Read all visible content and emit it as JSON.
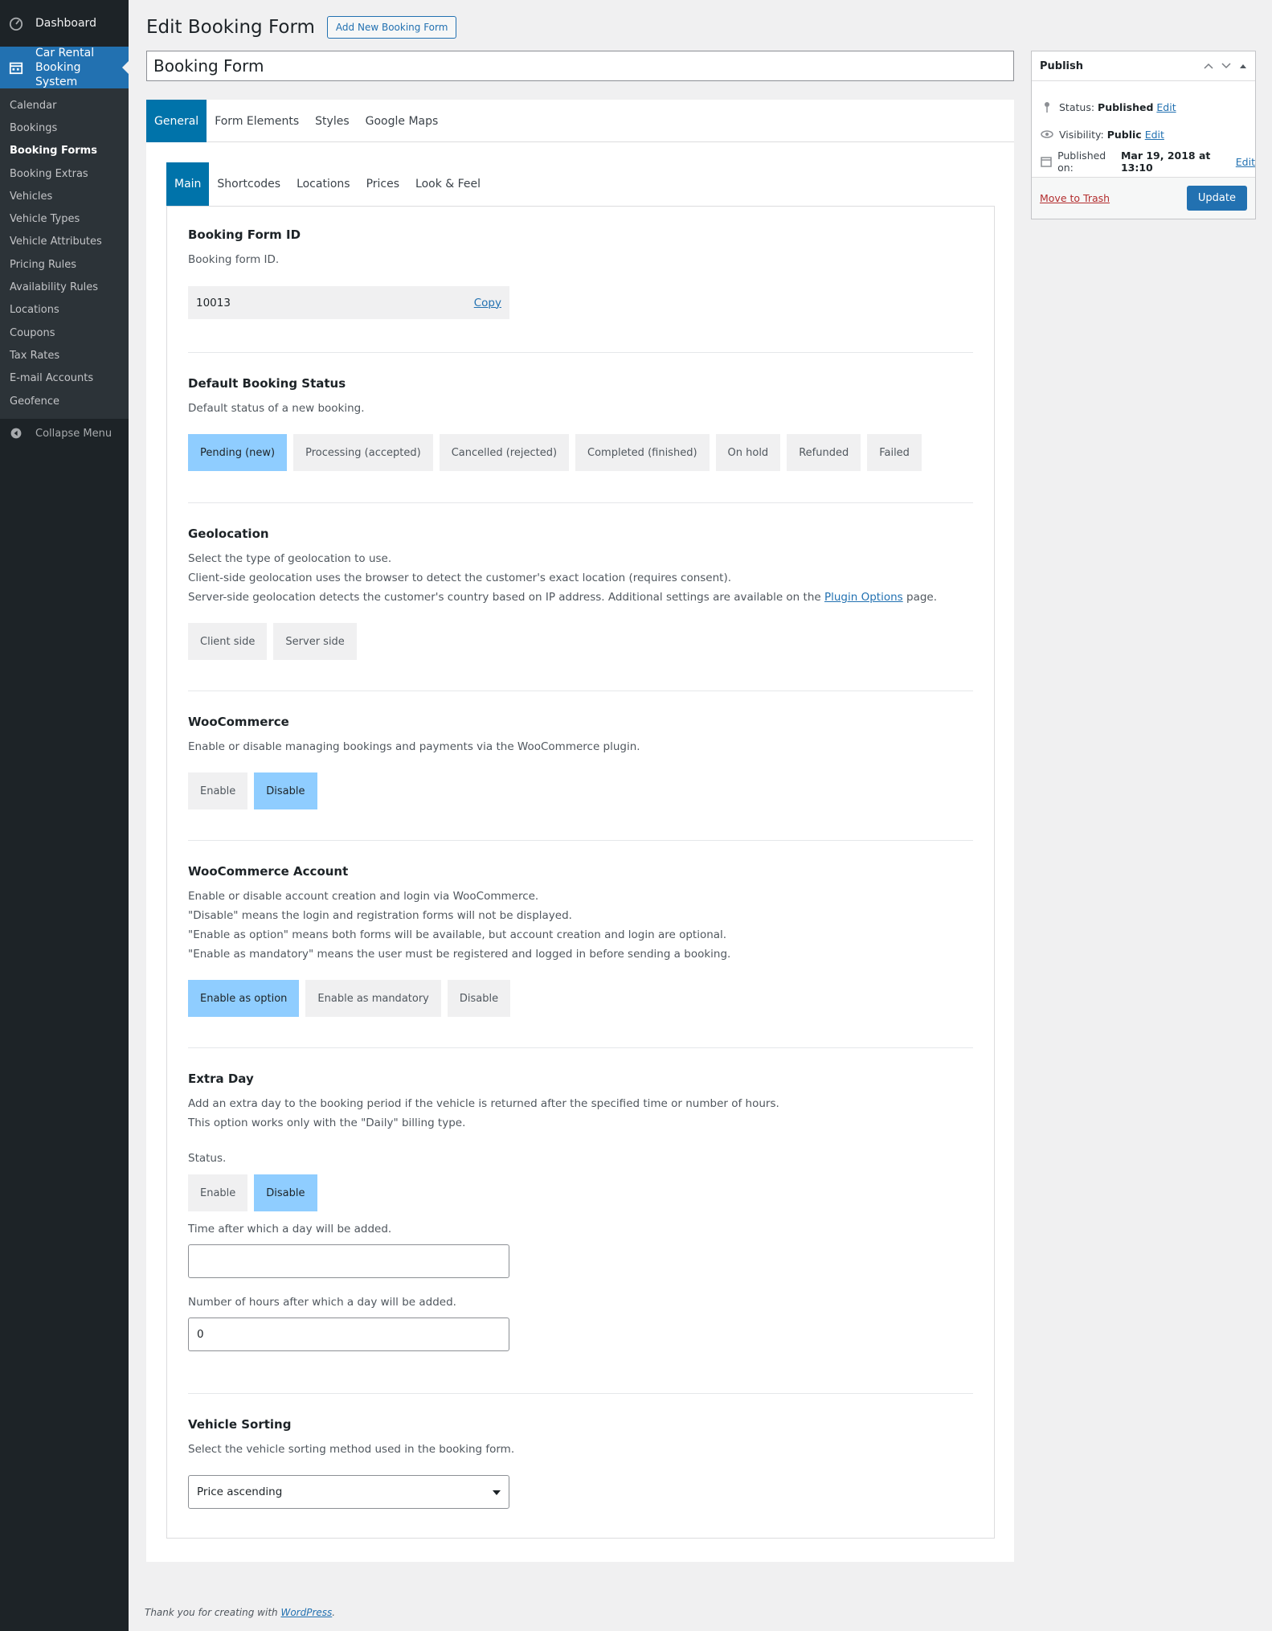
{
  "sidebar": {
    "dashboard": "Dashboard",
    "current": "Car Rental Booking System",
    "items": [
      {
        "label": "Calendar"
      },
      {
        "label": "Bookings"
      },
      {
        "label": "Booking Forms"
      },
      {
        "label": "Booking Extras"
      },
      {
        "label": "Vehicles"
      },
      {
        "label": "Vehicle Types"
      },
      {
        "label": "Vehicle Attributes"
      },
      {
        "label": "Pricing Rules"
      },
      {
        "label": "Availability Rules"
      },
      {
        "label": "Locations"
      },
      {
        "label": "Coupons"
      },
      {
        "label": "Tax Rates"
      },
      {
        "label": "E-mail Accounts"
      },
      {
        "label": "Geofence"
      }
    ],
    "collapse": "Collapse Menu"
  },
  "header": {
    "title": "Edit Booking Form",
    "add_new": "Add New Booking Form",
    "post_title": "Booking Form"
  },
  "tabs_main": [
    "General",
    "Form Elements",
    "Styles",
    "Google Maps"
  ],
  "tabs_sub": [
    "Main",
    "Shortcodes",
    "Locations",
    "Prices",
    "Look & Feel"
  ],
  "sections": {
    "form_id": {
      "title": "Booking Form ID",
      "desc": "Booking form ID.",
      "value": "10013",
      "copy": "Copy"
    },
    "status": {
      "title": "Default Booking Status",
      "desc": "Default status of a new booking.",
      "options": [
        "Pending (new)",
        "Processing (accepted)",
        "Cancelled (rejected)",
        "Completed (finished)",
        "On hold",
        "Refunded",
        "Failed"
      ]
    },
    "geo": {
      "title": "Geolocation",
      "line1": "Select the type of geolocation to use.",
      "line2": "Client-side geolocation uses the browser to detect the customer's exact location (requires consent).",
      "line3_pre": "Server-side geolocation detects the customer's country based on IP address. Additional settings are available on the ",
      "line3_link": "Plugin Options",
      "line3_post": " page.",
      "options": [
        "Client side",
        "Server side"
      ]
    },
    "woo": {
      "title": "WooCommerce",
      "desc": "Enable or disable managing bookings and payments via the WooCommerce plugin.",
      "options": [
        "Enable",
        "Disable"
      ]
    },
    "woo_account": {
      "title": "WooCommerce Account",
      "line1": "Enable or disable account creation and login via WooCommerce.",
      "line2": "\"Disable\" means the login and registration forms will not be displayed.",
      "line3": "\"Enable as option\" means both forms will be available, but account creation and login are optional.",
      "line4": "\"Enable as mandatory\" means the user must be registered and logged in before sending a booking.",
      "options": [
        "Enable as option",
        "Enable as mandatory",
        "Disable"
      ]
    },
    "extra_day": {
      "title": "Extra Day",
      "line1": "Add an extra day to the booking period if the vehicle is returned after the specified time or number of hours.",
      "line2": "This option works only with the \"Daily\" billing type.",
      "status_label": "Status.",
      "options": [
        "Enable",
        "Disable"
      ],
      "time_label": "Time after which a day will be added.",
      "time_value": "",
      "hours_label": "Number of hours after which a day will be added.",
      "hours_value": "0"
    },
    "sorting": {
      "title": "Vehicle Sorting",
      "desc": "Select the vehicle sorting method used in the booking form.",
      "selected": "Price ascending"
    }
  },
  "publish": {
    "title": "Publish",
    "status_label": "Status:",
    "status_value": "Published",
    "visibility_label": "Visibility:",
    "visibility_value": "Public",
    "published_label": "Published on:",
    "published_value": "Mar 19, 2018 at 13:10",
    "edit": "Edit",
    "trash": "Move to Trash",
    "update": "Update"
  },
  "footer": {
    "text": "Thank you for creating with ",
    "link": "WordPress",
    "end": "."
  }
}
